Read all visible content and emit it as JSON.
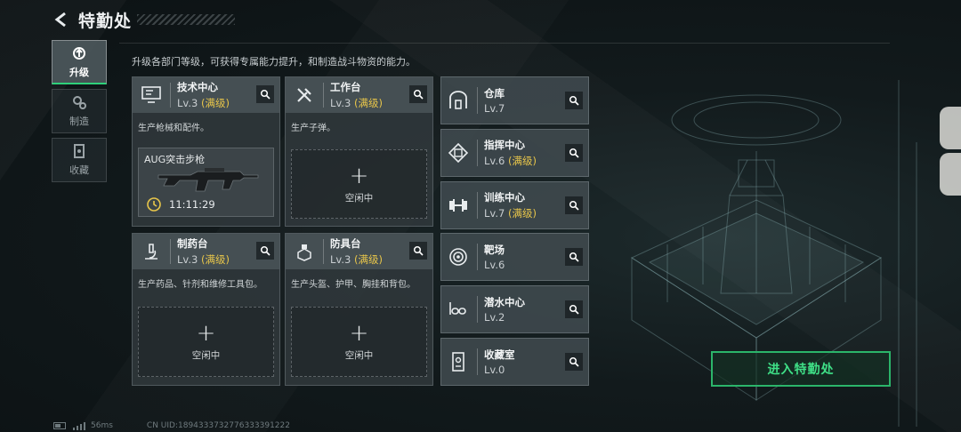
{
  "header": {
    "title": "特勤处"
  },
  "description": "升级各部门等级，可获得专属能力提升，和制造战斗物资的能力。",
  "nav": [
    {
      "label": "升级",
      "icon": "upgrade-icon",
      "active": true
    },
    {
      "label": "制造",
      "icon": "gears-icon",
      "active": false
    },
    {
      "label": "收藏",
      "icon": "collection-icon",
      "active": false
    }
  ],
  "facilities": {
    "tech": {
      "name": "技术中心",
      "level": "Lv.3",
      "max": "(满级)",
      "desc": "生产枪械和配件。",
      "craft": {
        "item": "AUG突击步枪",
        "timer": "11:11:29"
      }
    },
    "workbench": {
      "name": "工作台",
      "level": "Lv.3",
      "max": "(满级)",
      "desc": "生产子弹。",
      "slot": {
        "plus": "+",
        "status": "空闲中"
      }
    },
    "pharmacy": {
      "name": "制药台",
      "level": "Lv.3",
      "max": "(满级)",
      "desc": "生产药品、针剂和维修工具包。",
      "slot": {
        "plus": "+",
        "status": "空闲中"
      }
    },
    "armor": {
      "name": "防具台",
      "level": "Lv.3",
      "max": "(满级)",
      "desc": "生产头盔、护甲、胸挂和背包。",
      "slot": {
        "plus": "+",
        "status": "空闲中"
      }
    }
  },
  "side_facilities": [
    {
      "name": "仓库",
      "level": "Lv.7",
      "max": "",
      "icon": "warehouse-icon"
    },
    {
      "name": "指挥中心",
      "level": "Lv.6",
      "max": "(满级)",
      "icon": "command-center-icon"
    },
    {
      "name": "训练中心",
      "level": "Lv.7",
      "max": "(满级)",
      "icon": "dumbbell-icon"
    },
    {
      "name": "靶场",
      "level": "Lv.6",
      "max": "",
      "icon": "target-icon"
    },
    {
      "name": "潜水中心",
      "level": "Lv.2",
      "max": "",
      "icon": "diving-mask-icon"
    },
    {
      "name": "收藏室",
      "level": "Lv.0",
      "max": "",
      "icon": "collection-room-icon"
    }
  ],
  "enter_button": "进入特勤处",
  "footer": {
    "ping": "56ms",
    "uid": "CN UID:1894333732776333391222"
  },
  "colors": {
    "accent_green": "#2ed07a",
    "max_level": "#e8c64a"
  }
}
